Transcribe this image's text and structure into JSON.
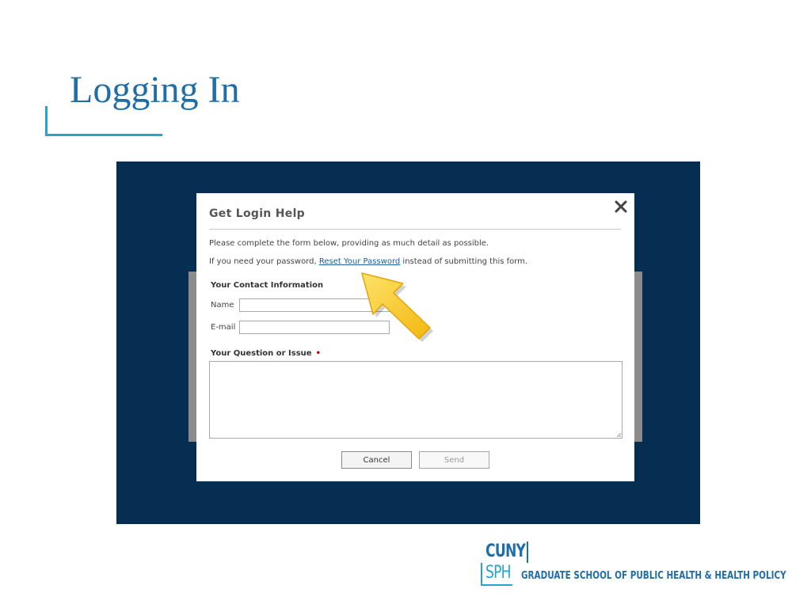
{
  "slide": {
    "title": "Logging In"
  },
  "dialog": {
    "title": "Get Login Help",
    "intro": "Please complete the form below, providing as much detail as possible.",
    "password_prefix": "If you need your password, ",
    "reset_link": "Reset Your Password",
    "password_suffix": " instead of submitting this form.",
    "contact_section": "Your Contact Information",
    "name_label": "Name",
    "name_value": "",
    "email_label": "E-mail",
    "email_value": "",
    "issue_section": "Your Question or Issue",
    "required_mark": "•",
    "issue_value": "",
    "cancel_label": "Cancel",
    "send_label": "Send"
  },
  "icons": {
    "close": "close-icon",
    "pointer": "arrow-icon"
  },
  "colors": {
    "title_blue": "#1f6ea8",
    "accent_teal": "#2aa3cc",
    "frame_navy": "#062d52",
    "arrow_yellow": "#f7c21b",
    "required_red": "#c00000",
    "link_blue": "#1f5c99"
  },
  "logo": {
    "line1": "CUNY",
    "line2": "SPH",
    "school": "GRADUATE SCHOOL OF PUBLIC HEALTH & HEALTH POLICY"
  }
}
